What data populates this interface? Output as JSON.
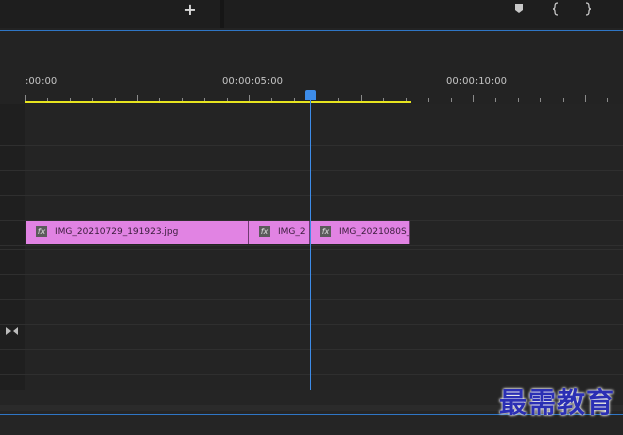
{
  "toolbar": {
    "add_label": "+",
    "marker_icon": "marker-icon",
    "in_point_icon": "in-point-icon",
    "out_point_icon": "out-point-icon"
  },
  "ruler": {
    "tick_labels": [
      ":00:00",
      "00:00:05:00",
      "00:00:10:00"
    ]
  },
  "clips": [
    {
      "label": "IMG_20210729_191923.jpg",
      "fx": "fx"
    },
    {
      "label": "IMG_2",
      "fx": "fx"
    },
    {
      "label": "IMG_2021080S_",
      "fx": "fx"
    }
  ],
  "track_icon": "collapse-icon",
  "watermark": "最需教育",
  "colors": {
    "clip": "#e183e3",
    "playhead": "#3d8ce8",
    "work_area": "#e7e41f",
    "background": "#232323"
  }
}
